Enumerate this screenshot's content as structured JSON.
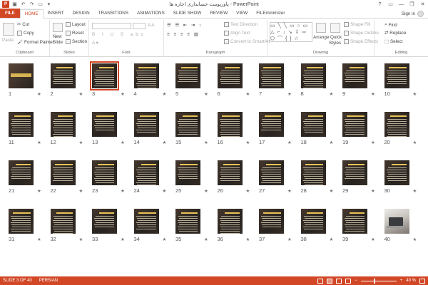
{
  "titlebar": {
    "app_letter": "P",
    "doc_title": "پاورپوینت حسابداری اجاره ها - PowerPoint",
    "help": "?",
    "minimize": "—",
    "restore": "❐",
    "close": "✕"
  },
  "tabs": [
    {
      "label": "FILE"
    },
    {
      "label": "HOME"
    },
    {
      "label": "INSERT"
    },
    {
      "label": "DESIGN"
    },
    {
      "label": "TRANSITIONS"
    },
    {
      "label": "ANIMATIONS"
    },
    {
      "label": "SLIDE SHOW"
    },
    {
      "label": "REVIEW"
    },
    {
      "label": "VIEW"
    },
    {
      "label": "FILEminimizer"
    }
  ],
  "signin": "Sign in",
  "ribbon": {
    "clipboard": {
      "paste": "Paste",
      "cut": "Cut",
      "copy": "Copy",
      "format_painter": "Format Painter",
      "label": "Clipboard"
    },
    "slides": {
      "new_slide": "New",
      "new_slide2": "Slide",
      "layout": "Layout",
      "reset": "Reset",
      "section": "Section",
      "label": "Slides"
    },
    "font": {
      "label": "Font"
    },
    "paragraph": {
      "text_direction": "Text Direction",
      "align_text": "Align Text",
      "convert_smartart": "Convert to SmartArt",
      "label": "Paragraph"
    },
    "drawing": {
      "arrange": "Arrange",
      "quick_styles": "Quick",
      "quick_styles2": "Styles",
      "shape_fill": "Shape Fill",
      "shape_outline": "Shape Outline",
      "shape_effects": "Shape Effects",
      "label": "Drawing"
    },
    "editing": {
      "find": "Find",
      "replace": "Replace",
      "select": "Select",
      "label": "Editing"
    }
  },
  "slides": [
    {
      "n": "1"
    },
    {
      "n": "2"
    },
    {
      "n": "3"
    },
    {
      "n": "4"
    },
    {
      "n": "5"
    },
    {
      "n": "6"
    },
    {
      "n": "7"
    },
    {
      "n": "8"
    },
    {
      "n": "9"
    },
    {
      "n": "10"
    },
    {
      "n": "11"
    },
    {
      "n": "12"
    },
    {
      "n": "13"
    },
    {
      "n": "14"
    },
    {
      "n": "15"
    },
    {
      "n": "16"
    },
    {
      "n": "17"
    },
    {
      "n": "18"
    },
    {
      "n": "19"
    },
    {
      "n": "20"
    },
    {
      "n": "21"
    },
    {
      "n": "22"
    },
    {
      "n": "23"
    },
    {
      "n": "24"
    },
    {
      "n": "25"
    },
    {
      "n": "26"
    },
    {
      "n": "27"
    },
    {
      "n": "28"
    },
    {
      "n": "29"
    },
    {
      "n": "30"
    },
    {
      "n": "31"
    },
    {
      "n": "32"
    },
    {
      "n": "33"
    },
    {
      "n": "34"
    },
    {
      "n": "35"
    },
    {
      "n": "36"
    },
    {
      "n": "37"
    },
    {
      "n": "38"
    },
    {
      "n": "39"
    },
    {
      "n": "40"
    }
  ],
  "selected_slide": "3",
  "status": {
    "slide_info": "SLIDE 3 OF 40",
    "language": "PERSIAN",
    "zoom": "40 %"
  },
  "colors": {
    "accent": "#d24726"
  }
}
